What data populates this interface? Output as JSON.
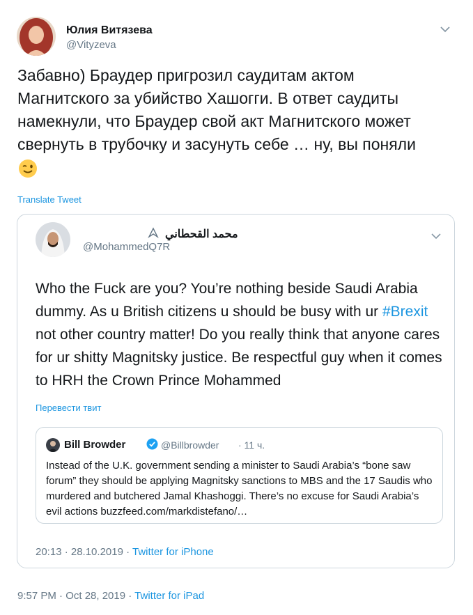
{
  "author": {
    "name": "Юлия Витязева",
    "handle": "@Vityzeva",
    "avatar_icon": "avatar-photo-woman"
  },
  "tweet": {
    "lines": [
      "Забавно) Браудер пригрозил саудитам актом",
      "Магнитского за убийство Хашогги. В ответ саудиты",
      "намекнули, что Браудер свой акт Магнитского может",
      "свернуть в трубочку и засунуть себе … ну, вы поняли"
    ],
    "emoji": "winking-face-emoji",
    "translate_label": "Translate Tweet"
  },
  "quoted": {
    "name": "محمد القحطاني",
    "handle": "@MohammedQ7R",
    "text_before_hashtag": "Who the Fuck are you? You’re nothing beside Saudi Arabia dummy. As u British citizens u should be busy with ur ",
    "hashtag": "#Brexit",
    "text_after_hashtag": " not other country matter! Do you really think that anyone cares for ur shitty Magnitsky justice. Be respectful guy when it comes to HRH the Crown Prince Mohammed",
    "translate_label": "Перевести твит",
    "timestamp": "20:13 · 28.10.2019 · ",
    "source": "Twitter for iPhone"
  },
  "nested": {
    "name": "Bill Browder",
    "handle": "@Billbrowder",
    "time": "· 11 ч.",
    "text": "Instead of the U.K. government sending a minister to Saudi Arabia’s “bone saw forum” they should be applying Magnitsky sanctions to MBS and the 17 Saudis who murdered and butchered Jamal Khashoggi. There’s no excuse for Saudi Arabia’s evil actions buzzfeed.com/markdistefano/…"
  },
  "footer": {
    "timestamp": "9:57 PM · Oct 28, 2019 · ",
    "source": "Twitter for iPad"
  },
  "colors": {
    "link": "#1b95e0",
    "secondary": "#657786",
    "border": "#ccd6dd"
  }
}
